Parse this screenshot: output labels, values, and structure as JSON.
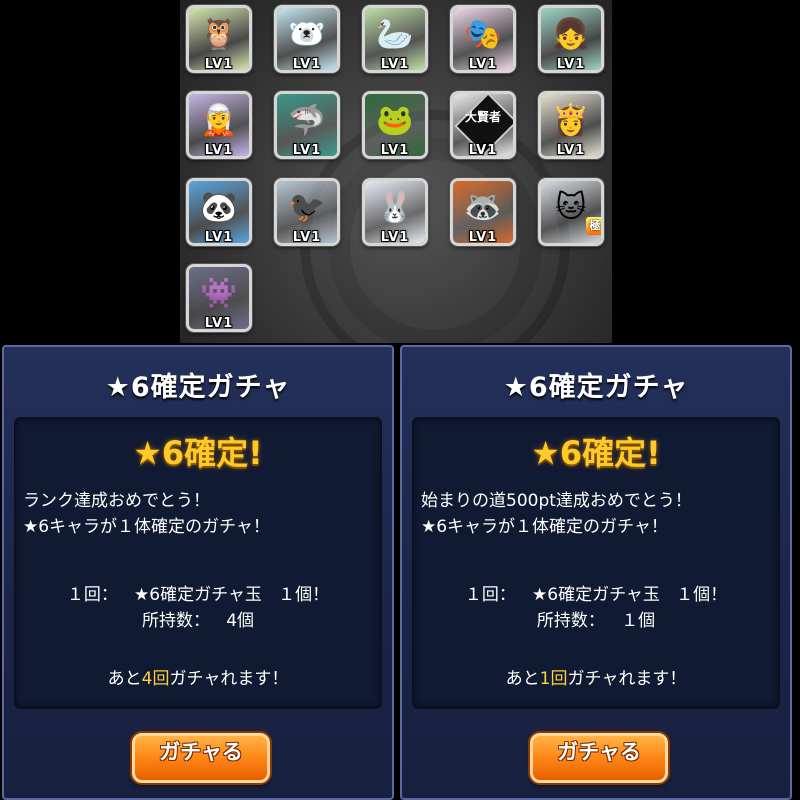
{
  "characters": [
    {
      "icon": "owl-icon",
      "glyph": "🦉",
      "bg": "#d8e8b0",
      "level": "LV1"
    },
    {
      "icon": "polar-bear-icon",
      "glyph": "🐻‍❄️",
      "bg": "#c7e7f0",
      "level": "LV1"
    },
    {
      "icon": "goose-icon",
      "glyph": "🦢",
      "bg": "#bfe0a8",
      "level": "LV1"
    },
    {
      "icon": "clown-mask-icon",
      "glyph": "🎭",
      "bg": "#f0d9ea",
      "level": "LV1"
    },
    {
      "icon": "girl-character-icon",
      "glyph": "👧",
      "bg": "#9fd6c6",
      "level": "LV1"
    },
    {
      "icon": "elf-girl-icon",
      "glyph": "🧝",
      "bg": "#c8b6e8",
      "level": "LV1"
    },
    {
      "icon": "red-shark-icon",
      "glyph": "🦈",
      "bg": "#3a9a8a",
      "level": "LV1"
    },
    {
      "icon": "frog-icon",
      "glyph": "🐸",
      "bg": "#2f6b3a",
      "level": "LV1"
    },
    {
      "icon": "great-sage-card-icon",
      "glyph": "大賢者",
      "bg": "#e8e8e8",
      "level": "LV1"
    },
    {
      "icon": "princess-icon",
      "glyph": "👸",
      "bg": "#e6e0d0",
      "level": "LV1"
    },
    {
      "icon": "panda-captain-icon",
      "glyph": "🐼",
      "bg": "#5aa6e0",
      "level": "LV1"
    },
    {
      "icon": "crow-icon",
      "glyph": "🐦‍⬛",
      "bg": "#b8c6d2",
      "level": "LV1"
    },
    {
      "icon": "white-rabbit-icon",
      "glyph": "🐰",
      "bg": "#e8eef6",
      "level": "LV1"
    },
    {
      "icon": "tanuki-icon",
      "glyph": "🦝",
      "bg": "#d76a2a",
      "level": "LV1"
    },
    {
      "icon": "white-cat-icon",
      "glyph": "🐱",
      "bg": "#d7dde4",
      "level": "",
      "badge": "極"
    },
    {
      "icon": "dark-fluff-monster-icon",
      "glyph": "👾",
      "bg": "#6d6f8a",
      "level": "LV1"
    }
  ],
  "dialogs": [
    {
      "title": "★6確定ガチャ",
      "headline": "★6確定!",
      "message_line1": "ランク達成おめでとう！",
      "message_line2": "★6キャラが１体確定のガチャ！",
      "cost_label": "１回：",
      "cost_item": "★6確定ガチャ玉",
      "cost_qty": "１個！",
      "owned_label": "所持数：",
      "owned_value": "4個",
      "remaining_prefix": "あと",
      "remaining_count": "4回",
      "remaining_suffix": "ガチャれます！",
      "button_label": "ガチャる"
    },
    {
      "title": "★6確定ガチャ",
      "headline": "★6確定!",
      "message_line1": "始まりの道500pt達成おめでとう！",
      "message_line2": "★6キャラが１体確定のガチャ！",
      "cost_label": "１回：",
      "cost_item": "★6確定ガチャ玉",
      "cost_qty": "１個！",
      "owned_label": "所持数：",
      "owned_value": "１個",
      "remaining_prefix": "あと",
      "remaining_count": "1回",
      "remaining_suffix": "ガチャれます！",
      "button_label": "ガチャる"
    }
  ]
}
